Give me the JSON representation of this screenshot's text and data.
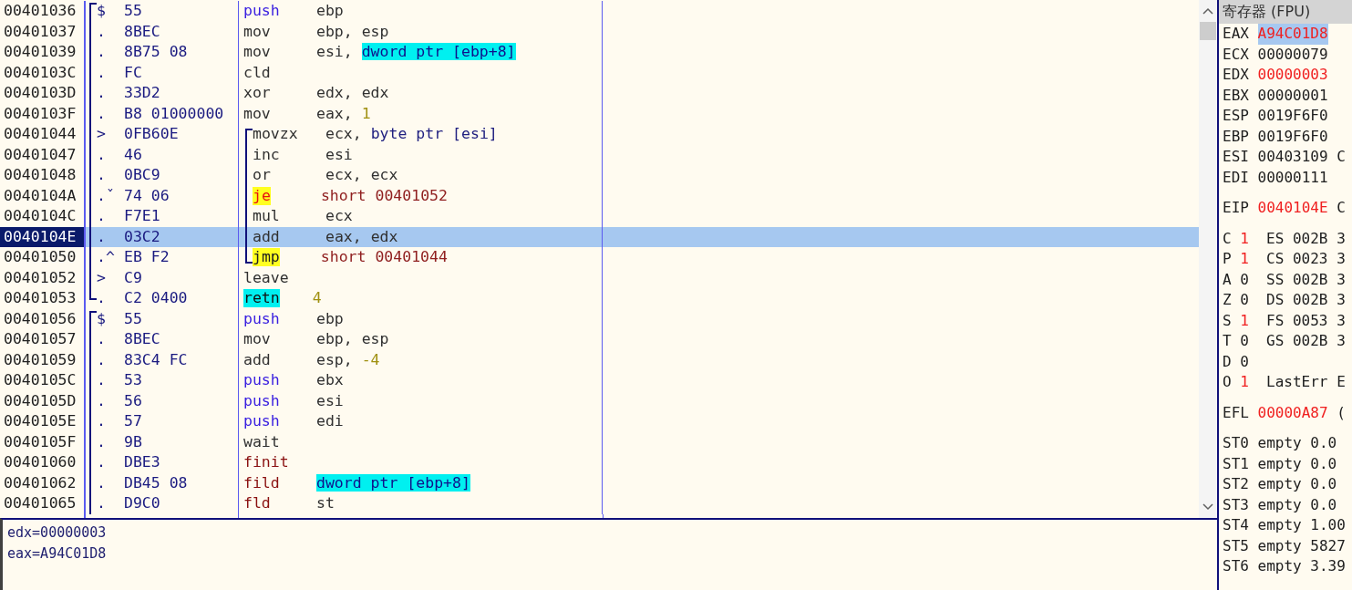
{
  "disassembly": {
    "rows": [
      {
        "address": "00401036",
        "proc": {
          "kind": "start"
        },
        "marker": "$",
        "hex": "55",
        "mnemonic": "push",
        "kind": "push",
        "operands": [
          {
            "text": "ebp",
            "kind": "plain"
          }
        ],
        "selected": false
      },
      {
        "address": "00401037",
        "proc": {
          "kind": "body"
        },
        "marker": ".",
        "hex": "8BEC",
        "mnemonic": "mov",
        "kind": "plain",
        "operands": [
          {
            "text": "ebp, esp",
            "kind": "plain"
          }
        ],
        "selected": false
      },
      {
        "address": "00401039",
        "proc": {
          "kind": "body"
        },
        "marker": ".",
        "hex": "8B75 08",
        "mnemonic": "mov",
        "kind": "plain",
        "operands": [
          {
            "text": "esi, ",
            "kind": "plain"
          },
          {
            "text": "dword ptr [ebp+8]",
            "kind": "mem"
          }
        ],
        "selected": false
      },
      {
        "address": "0040103C",
        "proc": {
          "kind": "body"
        },
        "marker": ".",
        "hex": "FC",
        "mnemonic": "cld",
        "kind": "plain",
        "operands": [],
        "selected": false
      },
      {
        "address": "0040103D",
        "proc": {
          "kind": "body"
        },
        "marker": ".",
        "hex": "33D2",
        "mnemonic": "xor",
        "kind": "plain",
        "operands": [
          {
            "text": "edx, edx",
            "kind": "plain"
          }
        ],
        "selected": false
      },
      {
        "address": "0040103F",
        "proc": {
          "kind": "body"
        },
        "marker": ".",
        "hex": "B8 01000000",
        "mnemonic": "mov",
        "kind": "plain",
        "operands": [
          {
            "text": "eax, ",
            "kind": "plain"
          },
          {
            "text": "1",
            "kind": "const"
          }
        ],
        "selected": false
      },
      {
        "address": "00401044",
        "proc": {
          "kind": "body"
        },
        "loop": {
          "kind": "start"
        },
        "marker": ">",
        "hex": "0FB60E",
        "mnemonic": "movzx",
        "kind": "plain",
        "operands": [
          {
            "text": "ecx, ",
            "kind": "plain"
          },
          {
            "text": "byte ptr [esi]",
            "kind": "ptr"
          }
        ],
        "selected": false
      },
      {
        "address": "00401047",
        "proc": {
          "kind": "body"
        },
        "loop": {
          "kind": "body"
        },
        "marker": ".",
        "hex": "46",
        "mnemonic": "inc",
        "kind": "plain",
        "operands": [
          {
            "text": "esi",
            "kind": "plain"
          }
        ],
        "selected": false
      },
      {
        "address": "00401048",
        "proc": {
          "kind": "body"
        },
        "loop": {
          "kind": "body"
        },
        "marker": ".",
        "hex": "0BC9",
        "mnemonic": "or",
        "kind": "plain",
        "operands": [
          {
            "text": "ecx, ecx",
            "kind": "plain"
          }
        ],
        "selected": false
      },
      {
        "address": "0040104A",
        "proc": {
          "kind": "body"
        },
        "loop": {
          "kind": "body"
        },
        "marker": ".ˇ",
        "hex": "74 06",
        "mnemonic": "je",
        "kind": "jcc",
        "operands": [
          {
            "text": "short 00401052",
            "kind": "target"
          }
        ],
        "selected": false
      },
      {
        "address": "0040104C",
        "proc": {
          "kind": "body"
        },
        "loop": {
          "kind": "body"
        },
        "marker": ".",
        "hex": "F7E1",
        "mnemonic": "mul",
        "kind": "plain",
        "operands": [
          {
            "text": "ecx",
            "kind": "plain"
          }
        ],
        "selected": false
      },
      {
        "address": "0040104E",
        "proc": {
          "kind": "body"
        },
        "loop": {
          "kind": "body"
        },
        "marker": ".",
        "hex": "03C2",
        "mnemonic": "add",
        "kind": "plain",
        "operands": [
          {
            "text": "eax, edx",
            "kind": "plain"
          }
        ],
        "selected": true
      },
      {
        "address": "00401050",
        "proc": {
          "kind": "body"
        },
        "loop": {
          "kind": "end"
        },
        "marker": ".^",
        "hex": "EB F2",
        "mnemonic": "jmp",
        "kind": "jmp",
        "operands": [
          {
            "text": "short 00401044",
            "kind": "target"
          }
        ],
        "selected": false
      },
      {
        "address": "00401052",
        "proc": {
          "kind": "body"
        },
        "marker": ">",
        "hex": "C9",
        "mnemonic": "leave",
        "kind": "plain",
        "operands": [],
        "selected": false
      },
      {
        "address": "00401053",
        "proc": {
          "kind": "end"
        },
        "marker": ".",
        "hex": "C2 0400",
        "mnemonic": "retn",
        "kind": "ret",
        "operands": [
          {
            "text": "4",
            "kind": "const"
          }
        ],
        "selected": false
      },
      {
        "address": "00401056",
        "proc": {
          "kind": "start"
        },
        "marker": "$",
        "hex": "55",
        "mnemonic": "push",
        "kind": "push",
        "operands": [
          {
            "text": "ebp",
            "kind": "plain"
          }
        ],
        "selected": false
      },
      {
        "address": "00401057",
        "proc": {
          "kind": "body"
        },
        "marker": ".",
        "hex": "8BEC",
        "mnemonic": "mov",
        "kind": "plain",
        "operands": [
          {
            "text": "ebp, esp",
            "kind": "plain"
          }
        ],
        "selected": false
      },
      {
        "address": "00401059",
        "proc": {
          "kind": "body"
        },
        "marker": ".",
        "hex": "83C4 FC",
        "mnemonic": "add",
        "kind": "plain",
        "operands": [
          {
            "text": "esp, ",
            "kind": "plain"
          },
          {
            "text": "-4",
            "kind": "const"
          }
        ],
        "selected": false
      },
      {
        "address": "0040105C",
        "proc": {
          "kind": "body"
        },
        "marker": ".",
        "hex": "53",
        "mnemonic": "push",
        "kind": "push",
        "operands": [
          {
            "text": "ebx",
            "kind": "plain"
          }
        ],
        "selected": false
      },
      {
        "address": "0040105D",
        "proc": {
          "kind": "body"
        },
        "marker": ".",
        "hex": "56",
        "mnemonic": "push",
        "kind": "push",
        "operands": [
          {
            "text": "esi",
            "kind": "plain"
          }
        ],
        "selected": false
      },
      {
        "address": "0040105E",
        "proc": {
          "kind": "body"
        },
        "marker": ".",
        "hex": "57",
        "mnemonic": "push",
        "kind": "push",
        "operands": [
          {
            "text": "edi",
            "kind": "plain"
          }
        ],
        "selected": false
      },
      {
        "address": "0040105F",
        "proc": {
          "kind": "body"
        },
        "marker": ".",
        "hex": "9B",
        "mnemonic": "wait",
        "kind": "plain",
        "operands": [],
        "selected": false
      },
      {
        "address": "00401060",
        "proc": {
          "kind": "body"
        },
        "marker": ".",
        "hex": "DBE3",
        "mnemonic": "finit",
        "kind": "fpu",
        "operands": [],
        "selected": false
      },
      {
        "address": "00401062",
        "proc": {
          "kind": "body"
        },
        "marker": ".",
        "hex": "DB45 08",
        "mnemonic": "fild",
        "kind": "fpu",
        "operands": [
          {
            "text": "dword ptr [ebp+8]",
            "kind": "mem"
          }
        ],
        "selected": false
      },
      {
        "address": "00401065",
        "proc": {
          "kind": "body"
        },
        "marker": ".",
        "hex": "D9C0",
        "mnemonic": "fld",
        "kind": "fpu",
        "operands": [
          {
            "text": "st",
            "kind": "plain"
          }
        ],
        "selected": false
      }
    ]
  },
  "info_pane": {
    "lines": [
      "edx=00000003",
      "eax=A94C01D8"
    ]
  },
  "registers": {
    "title": "寄存器 (FPU)",
    "general": [
      {
        "name": "EAX",
        "value": "A94C01D8",
        "changed": true,
        "selected": true
      },
      {
        "name": "ECX",
        "value": "00000079",
        "changed": false,
        "selected": false
      },
      {
        "name": "EDX",
        "value": "00000003",
        "changed": true,
        "selected": false
      },
      {
        "name": "EBX",
        "value": "00000001",
        "changed": false,
        "selected": false
      },
      {
        "name": "ESP",
        "value": "0019F6F0",
        "changed": false,
        "selected": false
      },
      {
        "name": "EBP",
        "value": "0019F6F0",
        "changed": false,
        "selected": false
      },
      {
        "name": "ESI",
        "value": "00403109",
        "changed": false,
        "selected": false,
        "note": "C"
      },
      {
        "name": "EDI",
        "value": "00000111",
        "changed": false,
        "selected": false
      }
    ],
    "eip": {
      "name": "EIP",
      "value": "0040104E",
      "changed": true,
      "note": "C"
    },
    "flags": [
      {
        "name": "C",
        "value": "1",
        "changed": true,
        "segment": "ES 002B 3"
      },
      {
        "name": "P",
        "value": "1",
        "changed": true,
        "segment": "CS 0023 3"
      },
      {
        "name": "A",
        "value": "0",
        "changed": false,
        "segment": "SS 002B 3"
      },
      {
        "name": "Z",
        "value": "0",
        "changed": false,
        "segment": "DS 002B 3"
      },
      {
        "name": "S",
        "value": "1",
        "changed": true,
        "segment": "FS 0053 3"
      },
      {
        "name": "T",
        "value": "0",
        "changed": false,
        "segment": "GS 002B 3"
      },
      {
        "name": "D",
        "value": "0",
        "changed": false
      },
      {
        "name": "O",
        "value": "1",
        "changed": true,
        "segment": "LastErr E"
      }
    ],
    "efl": {
      "name": "EFL",
      "value": "00000A87",
      "changed": true,
      "note": "("
    },
    "fpu": [
      "ST0 empty 0.0",
      "ST1 empty 0.0",
      "ST2 empty 0.0",
      "ST3 empty 0.0",
      "ST4 empty 1.00",
      "ST5 empty 5827",
      "ST6 empty 3.39"
    ]
  }
}
